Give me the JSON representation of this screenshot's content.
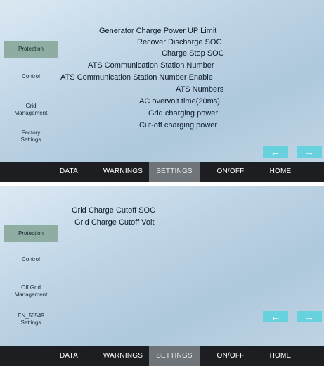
{
  "screen1": {
    "sidebar": {
      "protection": "Protection",
      "control": "Control",
      "grid_line1": "Grid",
      "grid_line2": "Management",
      "factory_line1": "Factory",
      "factory_line2": "Settings"
    },
    "settings": [
      "Generator Charge Power UP Limit",
      "Recover Discharge SOC",
      "Charge Stop SOC",
      "ATS Communication Station Number",
      "ATS Communication Station Number Enable",
      "ATS Numbers",
      "AC overvolt time(20ms)",
      "Grid charging power",
      "Cut-off charging power"
    ],
    "nav": {
      "prev": "←",
      "next": "→"
    },
    "tabs": {
      "data": "DATA",
      "warnings": "WARNINGS",
      "settings": "SETTINGS",
      "onoff": "ON/OFF",
      "home": "HOME"
    }
  },
  "screen2": {
    "sidebar": {
      "protection": "Protection",
      "control": "Control",
      "offgrid_line1": "Off Grid",
      "offgrid_line2": "Management",
      "en_line1": "EN_50549",
      "en_line2": "Settings"
    },
    "settings": [
      "Grid Charge Cutoff SOC",
      "Grid Charge Cutoff Volt"
    ],
    "nav": {
      "prev": "←",
      "next": "→"
    },
    "tabs": {
      "data": "DATA",
      "warnings": "WARNINGS",
      "settings": "SETTINGS",
      "onoff": "ON/OFF",
      "home": "HOME"
    }
  },
  "colors": {
    "active_sidebar": "#8fada3",
    "arrow_button": "#67d2dd",
    "tabbar": "#1d1e21",
    "active_tab": "#6f7478"
  }
}
